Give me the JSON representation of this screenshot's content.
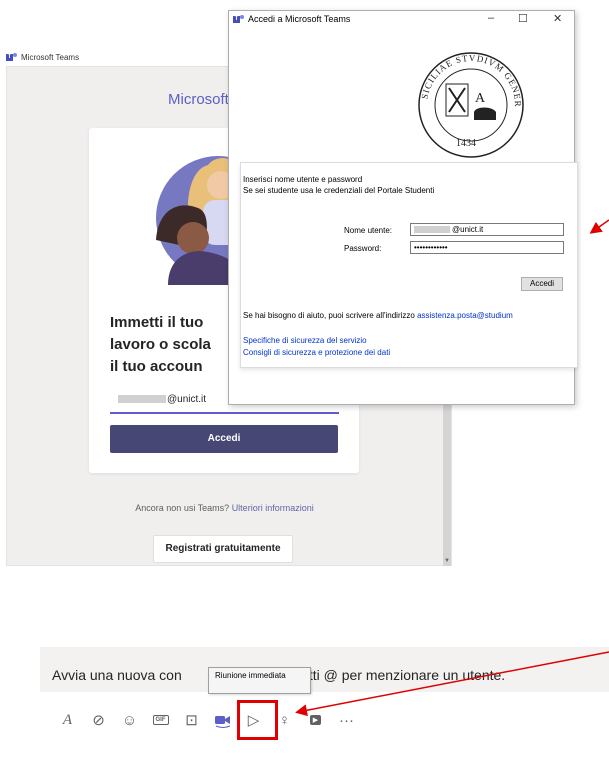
{
  "teams": {
    "window_title": "Microsoft Teams",
    "brand_heading": "Microsoft",
    "signin_heading_line1": "Immetti il tuo",
    "signin_heading_line2": "lavoro o scola",
    "signin_heading_line3": "il tuo accoun",
    "email_suffix": "@unict.it",
    "accedi_label": "Accedi",
    "ancora_text": "Ancora non usi Teams?",
    "ancora_link": "Ulteriori informazioni",
    "registrati_label": "Registrati gratuitamente"
  },
  "dialog": {
    "title": "Accedi a Microsoft Teams",
    "minimize_glyph": "–",
    "maximize_glyph": "☐",
    "close_glyph": "✕",
    "seal_top_text": "SICILIAE STVDIVM GENERALE",
    "seal_year": "1434",
    "seal_letter": "A",
    "instruction_line1": "Inserisci nome utente e password",
    "instruction_line2": "Se sei studente usa le credenziali del Portale Studenti",
    "username_label": "Nome utente:",
    "username_suffix": "@unict.it",
    "password_label": "Password:",
    "password_mask": "••••••••••••",
    "accedi_label": "Accedi",
    "help_text": "Se hai bisogno di aiuto, puoi scrivere all'indirizzo",
    "help_email": "assistenza.posta@studium",
    "link1": "Specifiche di sicurezza del servizio",
    "link2": "Consigli di sicurezza e protezione dei dati"
  },
  "compose": {
    "placeholder_left": "Avvia una nuova con",
    "placeholder_right": "mmetti @ per menzionare un utente.",
    "tooltip": "Riunione immediata",
    "tools": [
      {
        "name": "format-icon",
        "glyph": "A"
      },
      {
        "name": "attach-icon",
        "glyph": "⊘"
      },
      {
        "name": "emoji-icon",
        "glyph": "☺"
      },
      {
        "name": "gif-icon",
        "glyph": "GIF"
      },
      {
        "name": "sticker-icon",
        "glyph": "⊡"
      },
      {
        "name": "meet-now-icon",
        "glyph": "■"
      },
      {
        "name": "send-icon",
        "glyph": "▷"
      },
      {
        "name": "praise-icon",
        "glyph": "♀"
      },
      {
        "name": "youtube-icon",
        "glyph": "▶"
      },
      {
        "name": "more-options-icon",
        "glyph": "···"
      }
    ]
  },
  "colors": {
    "teams_purple": "#464775",
    "teams_accent": "#5b5fc7",
    "highlight_red": "#e00000"
  }
}
